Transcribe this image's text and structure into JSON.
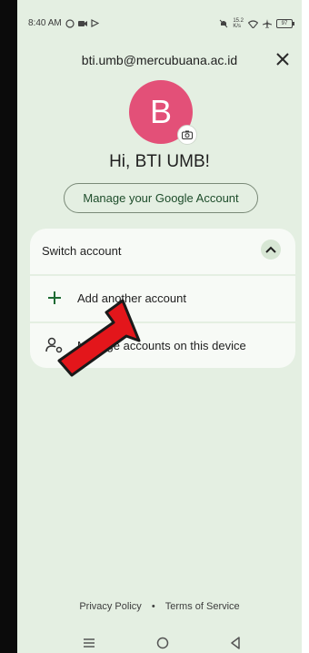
{
  "status_bar": {
    "time": "8:40 AM",
    "net_speed_top": "15.2",
    "net_speed_bottom": "K/s",
    "battery": "97"
  },
  "header": {
    "email": "bti.umb@mercubuana.ac.id"
  },
  "avatar": {
    "initial": "B",
    "color": "#e35078"
  },
  "greeting": "Hi, BTI UMB!",
  "manage_account_label": "Manage your Google Account",
  "switch_account": {
    "title": "Switch account",
    "items": [
      {
        "label": "Add another account",
        "icon": "plus-icon"
      },
      {
        "label": "Manage accounts on this device",
        "icon": "manage-accounts-icon"
      }
    ]
  },
  "footer": {
    "privacy": "Privacy Policy",
    "separator": "•",
    "terms": "Terms of Service"
  },
  "colors": {
    "screen_bg": "#e4efe2",
    "card_bg": "#f7faf6",
    "accent_green": "#1e4d2b",
    "arrow_red": "#e3161b"
  }
}
